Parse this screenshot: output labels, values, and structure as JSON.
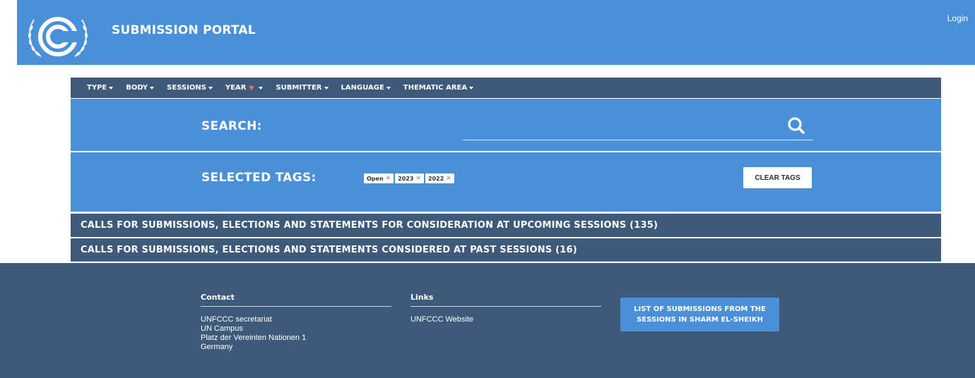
{
  "header": {
    "title": "SUBMISSION PORTAL",
    "login_label": "Login"
  },
  "nav": {
    "items": [
      {
        "label": "TYPE"
      },
      {
        "label": "BODY"
      },
      {
        "label": "SESSIONS"
      },
      {
        "label": "YEAR"
      },
      {
        "label": "SUBMITTER"
      },
      {
        "label": "LANGUAGE"
      },
      {
        "label": "THEMATIC AREA"
      }
    ]
  },
  "search": {
    "label": "SEARCH:",
    "value": "",
    "icon": "search-icon"
  },
  "tags": {
    "label": "SELECTED TAGS:",
    "items": [
      {
        "label": "Open"
      },
      {
        "label": "2023"
      },
      {
        "label": "2022"
      }
    ],
    "remove_glyph": "×",
    "clear_label": "CLEAR TAGS"
  },
  "sections": [
    {
      "label": "CALLS FOR SUBMISSIONS, ELECTIONS AND STATEMENTS FOR CONSIDERATION AT UPCOMING SESSIONS (135)"
    },
    {
      "label": "CALLS FOR SUBMISSIONS, ELECTIONS AND STATEMENTS CONSIDERED AT PAST SESSIONS (16)"
    }
  ],
  "footer": {
    "contact": {
      "title": "Contact",
      "lines": [
        "UNFCCC secretariat",
        "UN Campus",
        "Platz der Vereinten Nationen 1",
        "Germany"
      ]
    },
    "links": {
      "title": "Links",
      "items": [
        "UNFCCC Website"
      ]
    },
    "button": {
      "line1": "LIST OF SUBMISSIONS FROM THE",
      "line2": "SESSIONS IN SHARM EL-SHEIKH"
    }
  },
  "colors": {
    "brand_blue": "#4a90d9",
    "navy": "#3d5a7b"
  }
}
